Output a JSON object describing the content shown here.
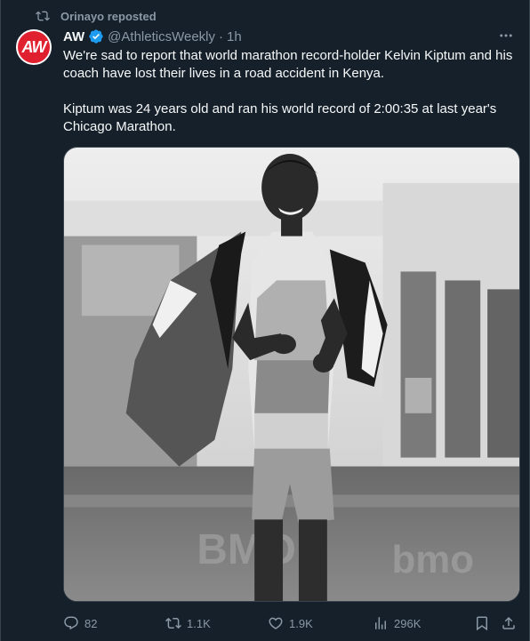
{
  "repost": {
    "icon": "repost-icon",
    "text": "Orinayo reposted"
  },
  "author": {
    "avatar_text": "AW",
    "avatar_color": "#e0202e",
    "display_name": "AW",
    "verified": true,
    "verified_color": "#1d9bf0",
    "handle": "@AthleticsWeekly",
    "separator": "·",
    "time": "1h"
  },
  "post": {
    "paragraph_1": "We're sad to report that world marathon record-holder Kelvin Kiptum and his coach have lost their lives in a road accident in Kenya.",
    "paragraph_2": "Kiptum was 24 years old and ran his world record of 2:00:35 at last year's Chicago Marathon."
  },
  "media": {
    "description_icon": "photo-black-white-runner-with-flag"
  },
  "actions": {
    "replies": "82",
    "reposts": "1.1K",
    "likes": "1.9K",
    "views": "296K"
  },
  "colors": {
    "background": "#15202b",
    "text_primary": "#f7f9f9",
    "text_secondary": "#8b98a5",
    "border": "#38444d"
  }
}
